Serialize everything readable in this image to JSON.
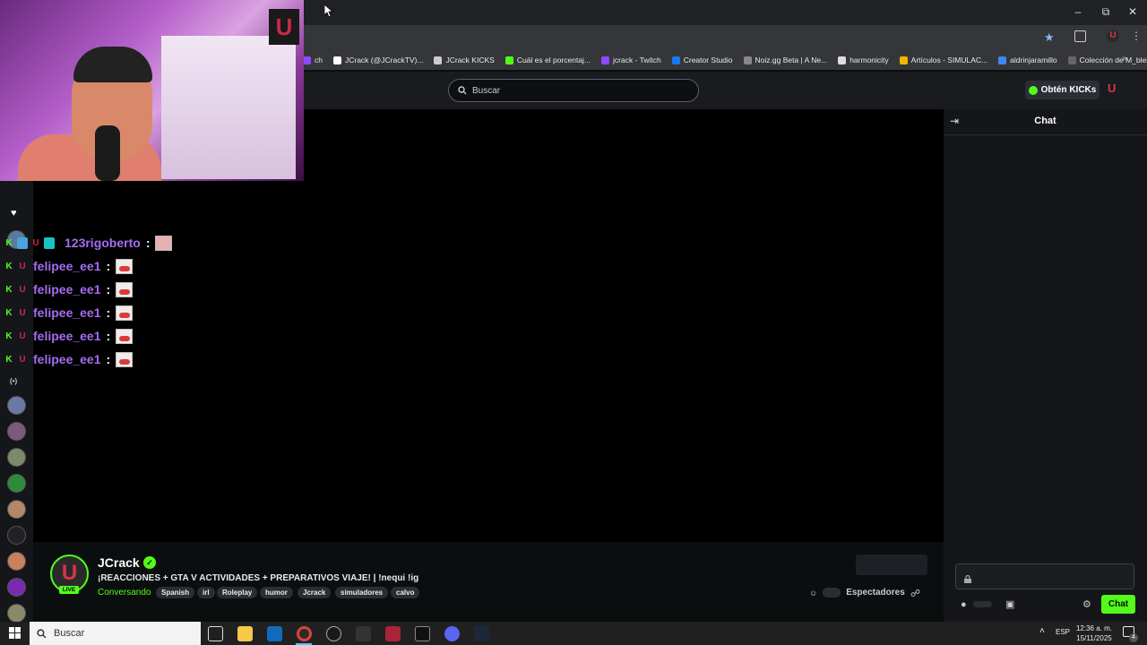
{
  "browser": {
    "bookmarks": [
      {
        "label": "ch",
        "icon": "bookmark-icon",
        "color": "#9146ff"
      },
      {
        "label": "JCrack (@JCrackTV)...",
        "icon": "x-logo-icon",
        "color": "#ffffff"
      },
      {
        "label": "JCrack KICKS",
        "icon": "kick-icon",
        "color": "#cccccc"
      },
      {
        "label": "Cuál es el porcentaj...",
        "icon": "kick-icon",
        "color": "#53fc18"
      },
      {
        "label": "jcrack - Twitch",
        "icon": "twitch-icon",
        "color": "#9146ff"
      },
      {
        "label": "Creator Studio",
        "icon": "facebook-icon",
        "color": "#1877f2"
      },
      {
        "label": "Noiz.gg Beta | A Ne...",
        "icon": "noiz-icon",
        "color": "#888888"
      },
      {
        "label": "harmonicity",
        "icon": "harmonicity-icon",
        "color": "#dddddd"
      },
      {
        "label": "Artículos - SIMULAC...",
        "icon": "drive-icon",
        "color": "#f4b400"
      },
      {
        "label": "aldrinjaramillo",
        "icon": "docs-icon",
        "color": "#4285f4"
      },
      {
        "label": "Colección de M_blei...",
        "icon": "globe-icon",
        "color": "#666666"
      }
    ]
  },
  "site": {
    "search_placeholder": "Buscar",
    "kicks_button": "Obtén KICKs",
    "user_logo": "U"
  },
  "chat_overlay": [
    {
      "username": "123rigoberto",
      "sep": ":",
      "emote": "pink"
    },
    {
      "username": "felipee_ee1",
      "sep": ":",
      "emote": "red"
    },
    {
      "username": "felipee_ee1",
      "sep": ":",
      "emote": "red"
    },
    {
      "username": "felipee_ee1",
      "sep": ":",
      "emote": "red"
    },
    {
      "username": "felipee_ee1",
      "sep": ":",
      "emote": "red"
    },
    {
      "username": "felipee_ee1",
      "sep": ":",
      "emote": "red"
    }
  ],
  "chat_panel": {
    "title": "Chat",
    "send_label": "Chat"
  },
  "channel": {
    "name": "JCrack",
    "live_label": "LIVE",
    "title": "¡REACCIONES + GTA V ACTIVIDADES + PREPARATIVOS VIAJE! | !nequi !ig",
    "category": "Conversando",
    "tags": [
      "Spanish",
      "irl",
      "Roleplay",
      "humor",
      "Jcrack",
      "simuladores",
      "calvo"
    ],
    "viewers_label": "Espectadores"
  },
  "taskbar": {
    "search_placeholder": "Buscar",
    "language": "ESP",
    "time": "12:36 a. m.",
    "date": "15/11/2025",
    "notification_count": "4"
  },
  "colors": {
    "kick_green": "#53fc18",
    "username_purple": "#a46cf0",
    "brand_red": "#d9334f"
  }
}
